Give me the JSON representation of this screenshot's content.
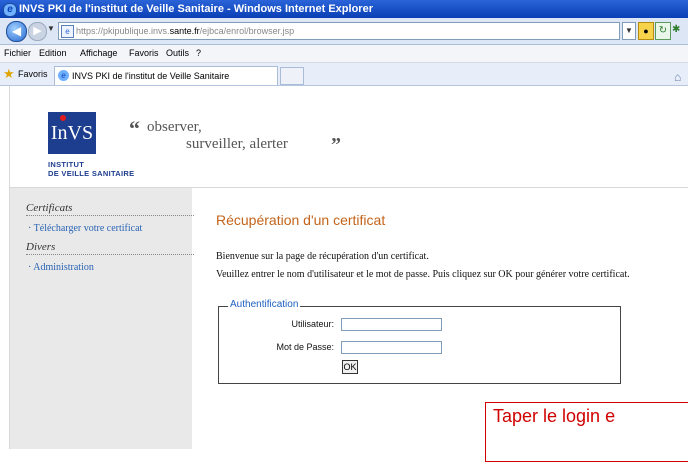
{
  "window": {
    "title": "INVS PKI de l'institut de Veille Sanitaire - Windows Internet Explorer"
  },
  "address_bar": {
    "url_prefix": "https://pkipublique.invs.",
    "url_domain": "sante.fr",
    "url_path": "/ejbca/enrol/browser.jsp"
  },
  "menu": {
    "items": [
      "Fichier",
      "Edition",
      "Affichage",
      "Favoris",
      "Outils",
      "?"
    ]
  },
  "favorites_bar": {
    "favorites_label": "Favoris",
    "active_tab": "INVS PKI de l'institut de Veille Sanitaire"
  },
  "header": {
    "logo_text": "InVS",
    "logo_line1": "INSTITUT",
    "logo_line2": "DE VEILLE SANITAIRE",
    "motto_line1": "observer,",
    "motto_line2": "surveiller, alerter",
    "quote_open": "“",
    "quote_close": "”"
  },
  "sidebar": {
    "section1_heading": "Certificats",
    "section1_link": "Télécharger votre certificat",
    "section2_heading": "Divers",
    "section2_link": "Administration"
  },
  "main": {
    "title": "Récupération d'un certificat",
    "intro1": "Bienvenue sur la page de récupération d'un certificat.",
    "intro2": "Veuillez entrer le nom d'utilisateur et le mot de passe. Puis cliquez sur OK pour générer votre certificat.",
    "auth": {
      "legend": "Authentification",
      "user_label": "Utilisateur:",
      "user_value": "",
      "pass_label": "Mot de Passe:",
      "pass_value": "",
      "ok_label": "OK"
    }
  },
  "annotation": {
    "callout_text": "Taper le login e"
  },
  "colors": {
    "title_bar": "#0a3fb5",
    "section_title": "#c4641a",
    "link": "#2a64b4",
    "callout": "#d00000",
    "logo": "#1d3d8f"
  }
}
